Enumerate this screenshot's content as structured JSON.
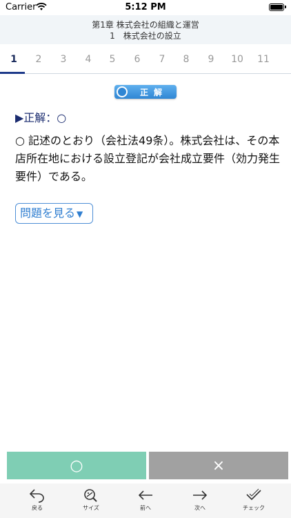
{
  "status": {
    "carrier": "Carrier",
    "time": "5:12 PM"
  },
  "header": {
    "chapter": "第1章 株式会社の組織と運営",
    "section": "1　株式会社の設立"
  },
  "tabs": [
    "1",
    "2",
    "3",
    "4",
    "5",
    "6",
    "7",
    "8",
    "9",
    "10",
    "11"
  ],
  "active_tab": "1",
  "result": {
    "badge": "正解"
  },
  "answer_line": "▶正解：○",
  "explanation": "○ 記述のとおり（会社法49条）。株式会社は、その本店所在地における設立登記が会社成立要件（効力発生要件）である。",
  "show_question": {
    "label": "問題を見る",
    "arrow": "▼"
  },
  "judge": {
    "correct": "○",
    "wrong": "×"
  },
  "toolbar": {
    "back": "戻る",
    "size": "サイズ",
    "prev": "前へ",
    "next": "次へ",
    "check": "チェック"
  },
  "colors": {
    "accent": "#1e3a8a",
    "correct": "#7fceb4",
    "wrong": "#a1a1a1",
    "badge": "#2f86d4"
  }
}
